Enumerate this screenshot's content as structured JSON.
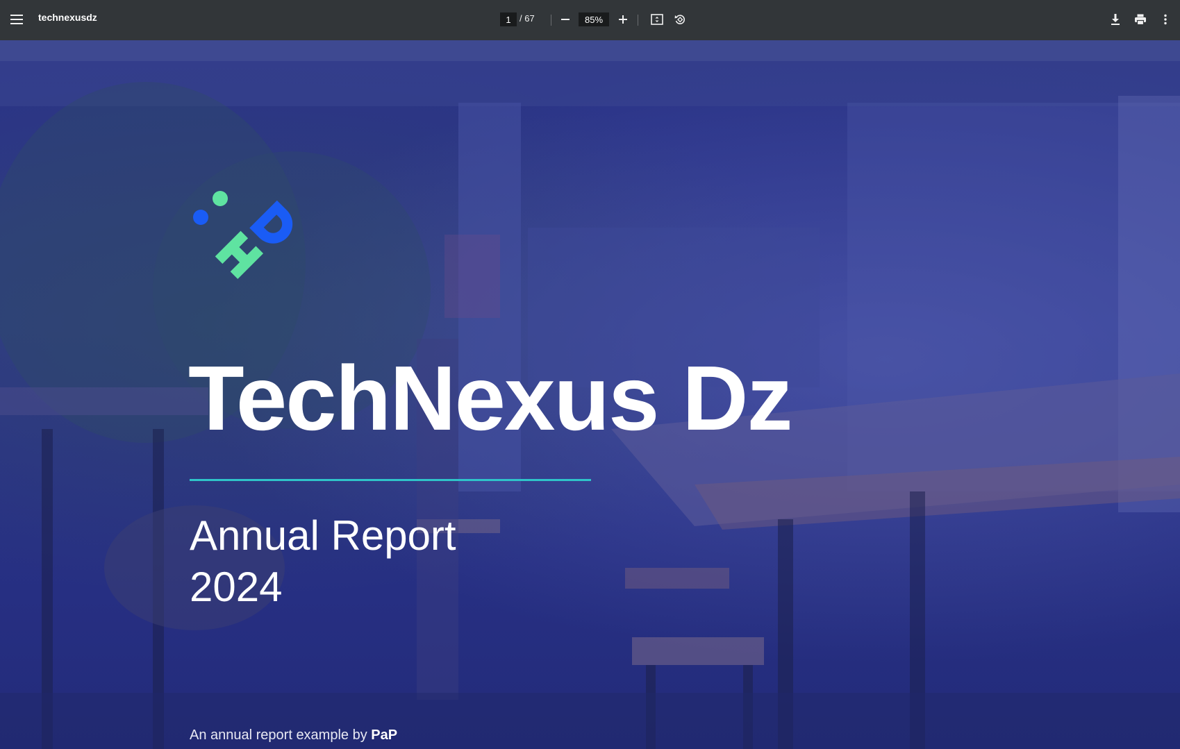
{
  "toolbar": {
    "title": "technexusdz",
    "current_page": "1",
    "page_total": "/ 67",
    "zoom": "85%"
  },
  "document": {
    "logo_letters": "DH",
    "brand": "TechNexus Dz",
    "report_title": "Annual Report",
    "report_year": "2024",
    "credit_prefix": "An annual report example by",
    "credit_author": "PaP"
  },
  "colors": {
    "toolbar_bg": "#323639",
    "overlay_blue": "#2c3690",
    "accent_teal": "#2fc4c9",
    "logo_blue": "#1a5cf5",
    "logo_green": "#5fe3a1"
  },
  "icons": [
    "menu-icon",
    "zoom-out-icon",
    "zoom-in-icon",
    "fit-page-icon",
    "rotate-icon",
    "download-icon",
    "print-icon",
    "more-vert-icon"
  ]
}
